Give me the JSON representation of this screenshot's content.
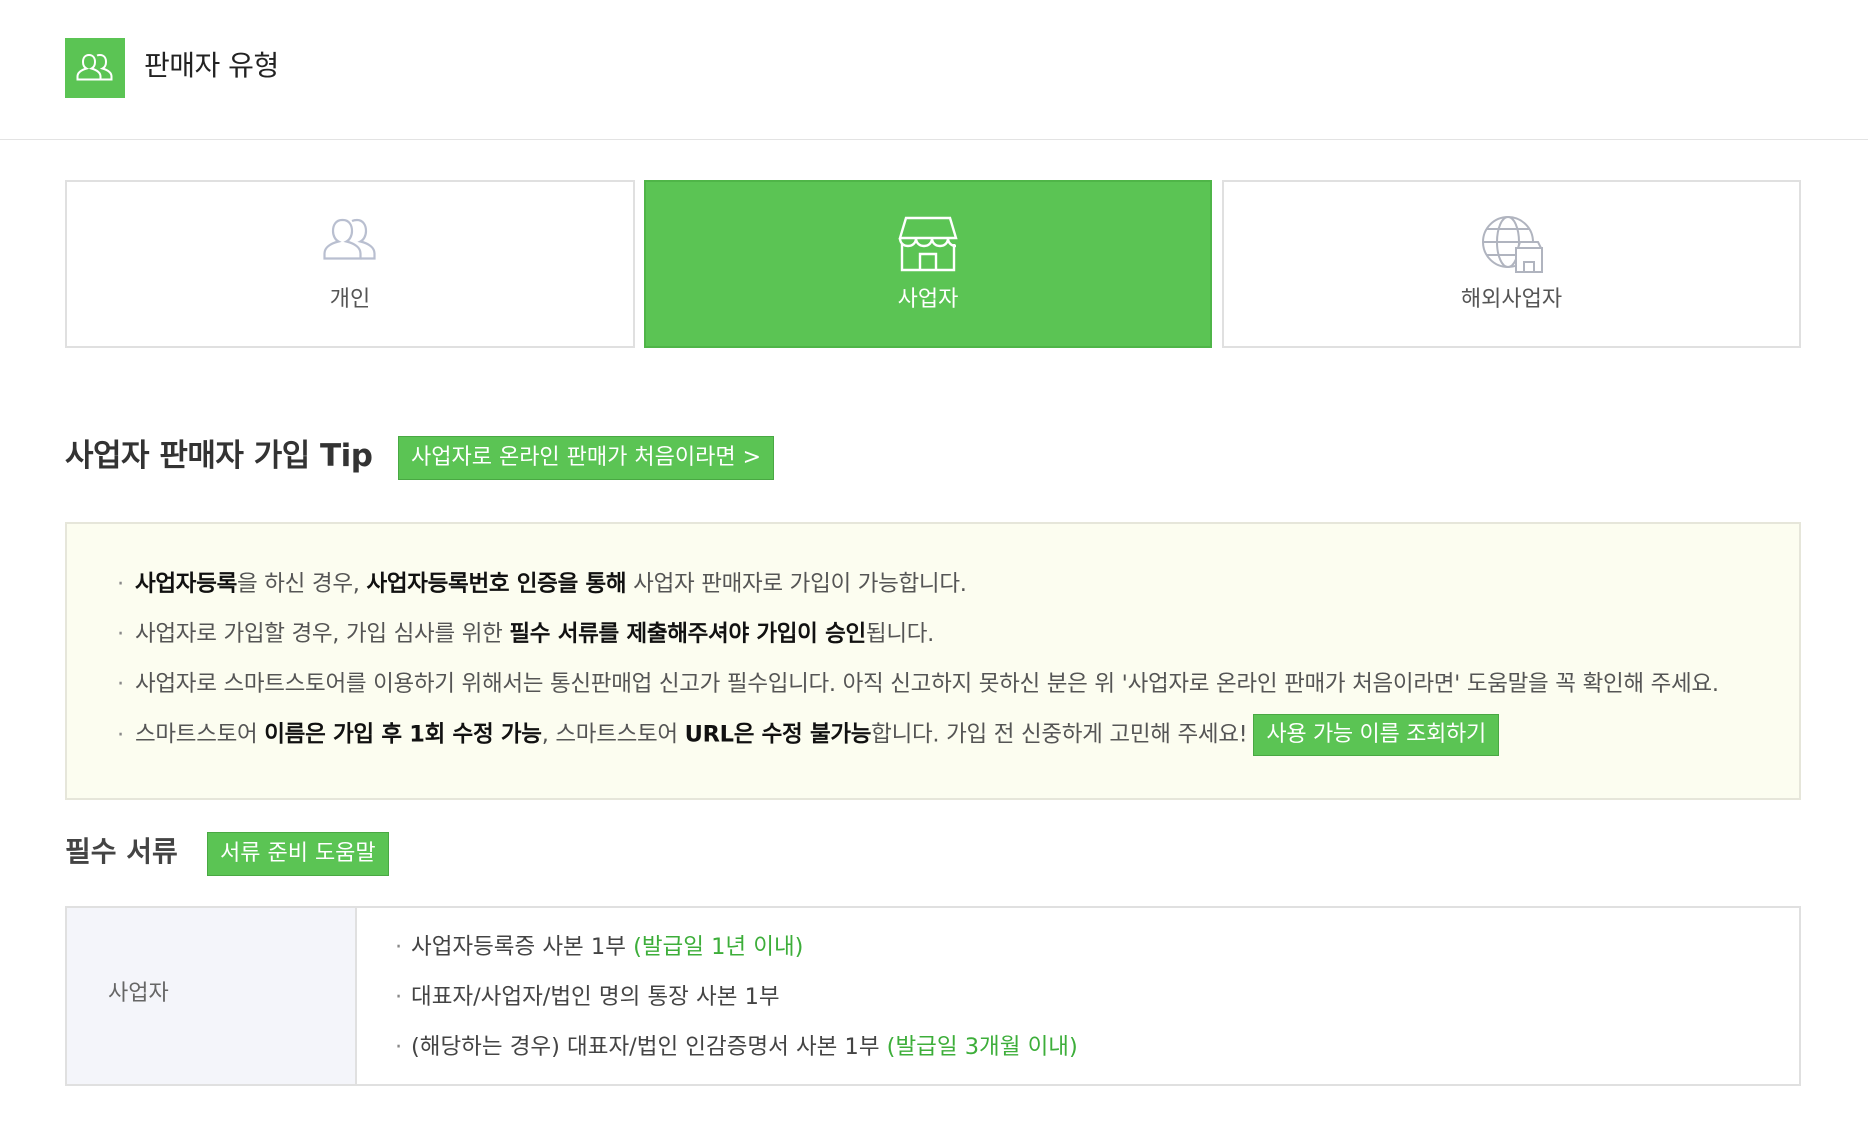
{
  "header": {
    "title": "판매자 유형",
    "icon": "users-icon"
  },
  "seller_types": [
    {
      "label": "개인",
      "icon": "user-pair-icon",
      "selected": false
    },
    {
      "label": "사업자",
      "icon": "storefront-icon",
      "selected": true
    },
    {
      "label": "해외사업자",
      "icon": "globe-store-icon",
      "selected": false
    }
  ],
  "tip": {
    "title": "사업자 판매자 가입 Tip",
    "online_sales_button": "사업자로 온라인 판매가 처음이라면 >",
    "lines": [
      {
        "part1": "사업자등록",
        "part2": "을 하신 경우, ",
        "part3": "사업자등록번호 인증을 통해",
        "part4": " 사업자 판매자로 가입이 가능합니다."
      },
      {
        "part1": "사업자로 가입할 경우, 가입 심사를 위한 ",
        "part2": "필수 서류를 제출해주셔야 가입이 승인",
        "part3": "됩니다."
      },
      {
        "text": "사업자로 스마트스토어를 이용하기 위해서는 통신판매업 신고가 필수입니다. 아직 신고하지 못하신 분은 위 '사업자로 온라인 판매가 처음이라면' 도움말을 꼭 확인해 주세요."
      },
      {
        "part1": "스마트스토어 ",
        "part2": "이름은 가입 후 1회 수정 가능",
        "part3": ", 스마트스토어 ",
        "part4": "URL은 수정 불가능",
        "part5": "합니다. 가입 전 신중하게 고민해 주세요!",
        "button": "사용 가능 이름 조회하기"
      }
    ],
    "bullet": "·"
  },
  "required_docs": {
    "title": "필수 서류",
    "help_button": "서류 준비 도움말",
    "row_header": "사업자",
    "items": [
      {
        "text": "사업자등록증 사본 1부 ",
        "note": "(발급일 1년 이내)"
      },
      {
        "text": "대표자/사업자/법인 명의 통장 사본 1부",
        "note": ""
      },
      {
        "text": "(해당하는 경우) 대표자/법인 인감증명서 사본 1부 ",
        "note": "(발급일 3개월 이내)"
      }
    ]
  },
  "colors": {
    "accent": "#5bc454",
    "note": "#3dae3a",
    "tip_background": "#fcfdf0",
    "table_header_background": "#f4f5fa"
  }
}
